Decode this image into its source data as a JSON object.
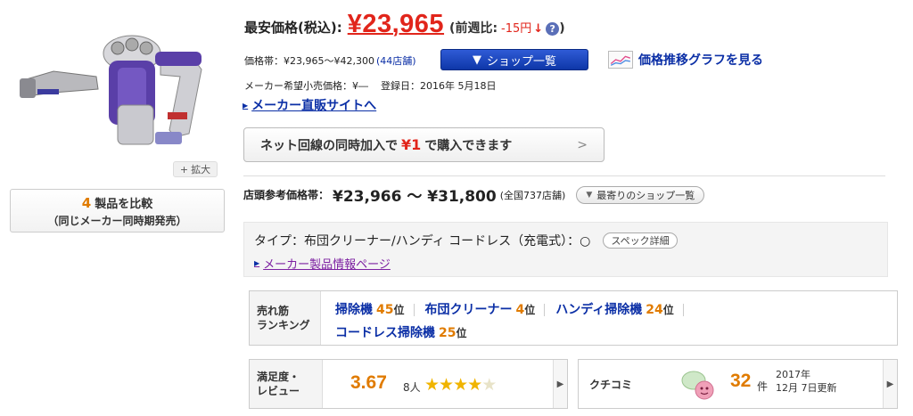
{
  "left": {
    "zoom_label": "拡大",
    "compare": {
      "count": "4",
      "label": "製品を比較",
      "sub": "（同じメーカー同時期発売）"
    }
  },
  "price": {
    "label": "最安価格(税込):",
    "value": "¥23,965",
    "prev_label": "(前週比:",
    "prev_value": "-15円",
    "prev_arrow": "↓",
    "help": "?",
    "close_paren": ")"
  },
  "range": {
    "label": "価格帯：¥23,965～¥42,300",
    "shops": "(44店舗)"
  },
  "shop_list_button": "ショップ一覧",
  "graph_link": "価格推移グラフを見る",
  "maker": {
    "msrp": "メーカー希望小売価格：¥―",
    "registered": "登録日：2016年 5月18日"
  },
  "direct_link": "メーカー直販サイトへ",
  "net_offer": {
    "pre": "ネット回線の同時加入で",
    "yen": "¥1",
    "post": "で購入できます"
  },
  "store": {
    "label": "店頭参考価格帯：",
    "range": "¥23,966 ～ ¥31,800",
    "count": "(全国737店舗)",
    "nearest_button": "最寄りのショップ一覧"
  },
  "spec": {
    "type": "タイプ：布団クリーナー/ハンディ コードレス（充電式）：○",
    "detail_button": "スペック詳細",
    "info_link": "メーカー製品情報ページ"
  },
  "ranking": {
    "label1": "売れ筋",
    "label2": "ランキング",
    "unit": "位",
    "items": [
      {
        "name": "掃除機",
        "pos": "45"
      },
      {
        "name": "布団クリーナー",
        "pos": "4"
      },
      {
        "name": "ハンディ掃除機",
        "pos": "24"
      },
      {
        "name": "コードレス掃除機",
        "pos": "25"
      }
    ]
  },
  "review": {
    "label1": "満足度・",
    "label2": "レビュー",
    "score": "3.67",
    "count": "8人",
    "rating": 3.67
  },
  "kuchikomi": {
    "label": "クチコミ",
    "count": "32",
    "unit": "件",
    "date1": "2017年",
    "date2": "12月 7日更新"
  }
}
